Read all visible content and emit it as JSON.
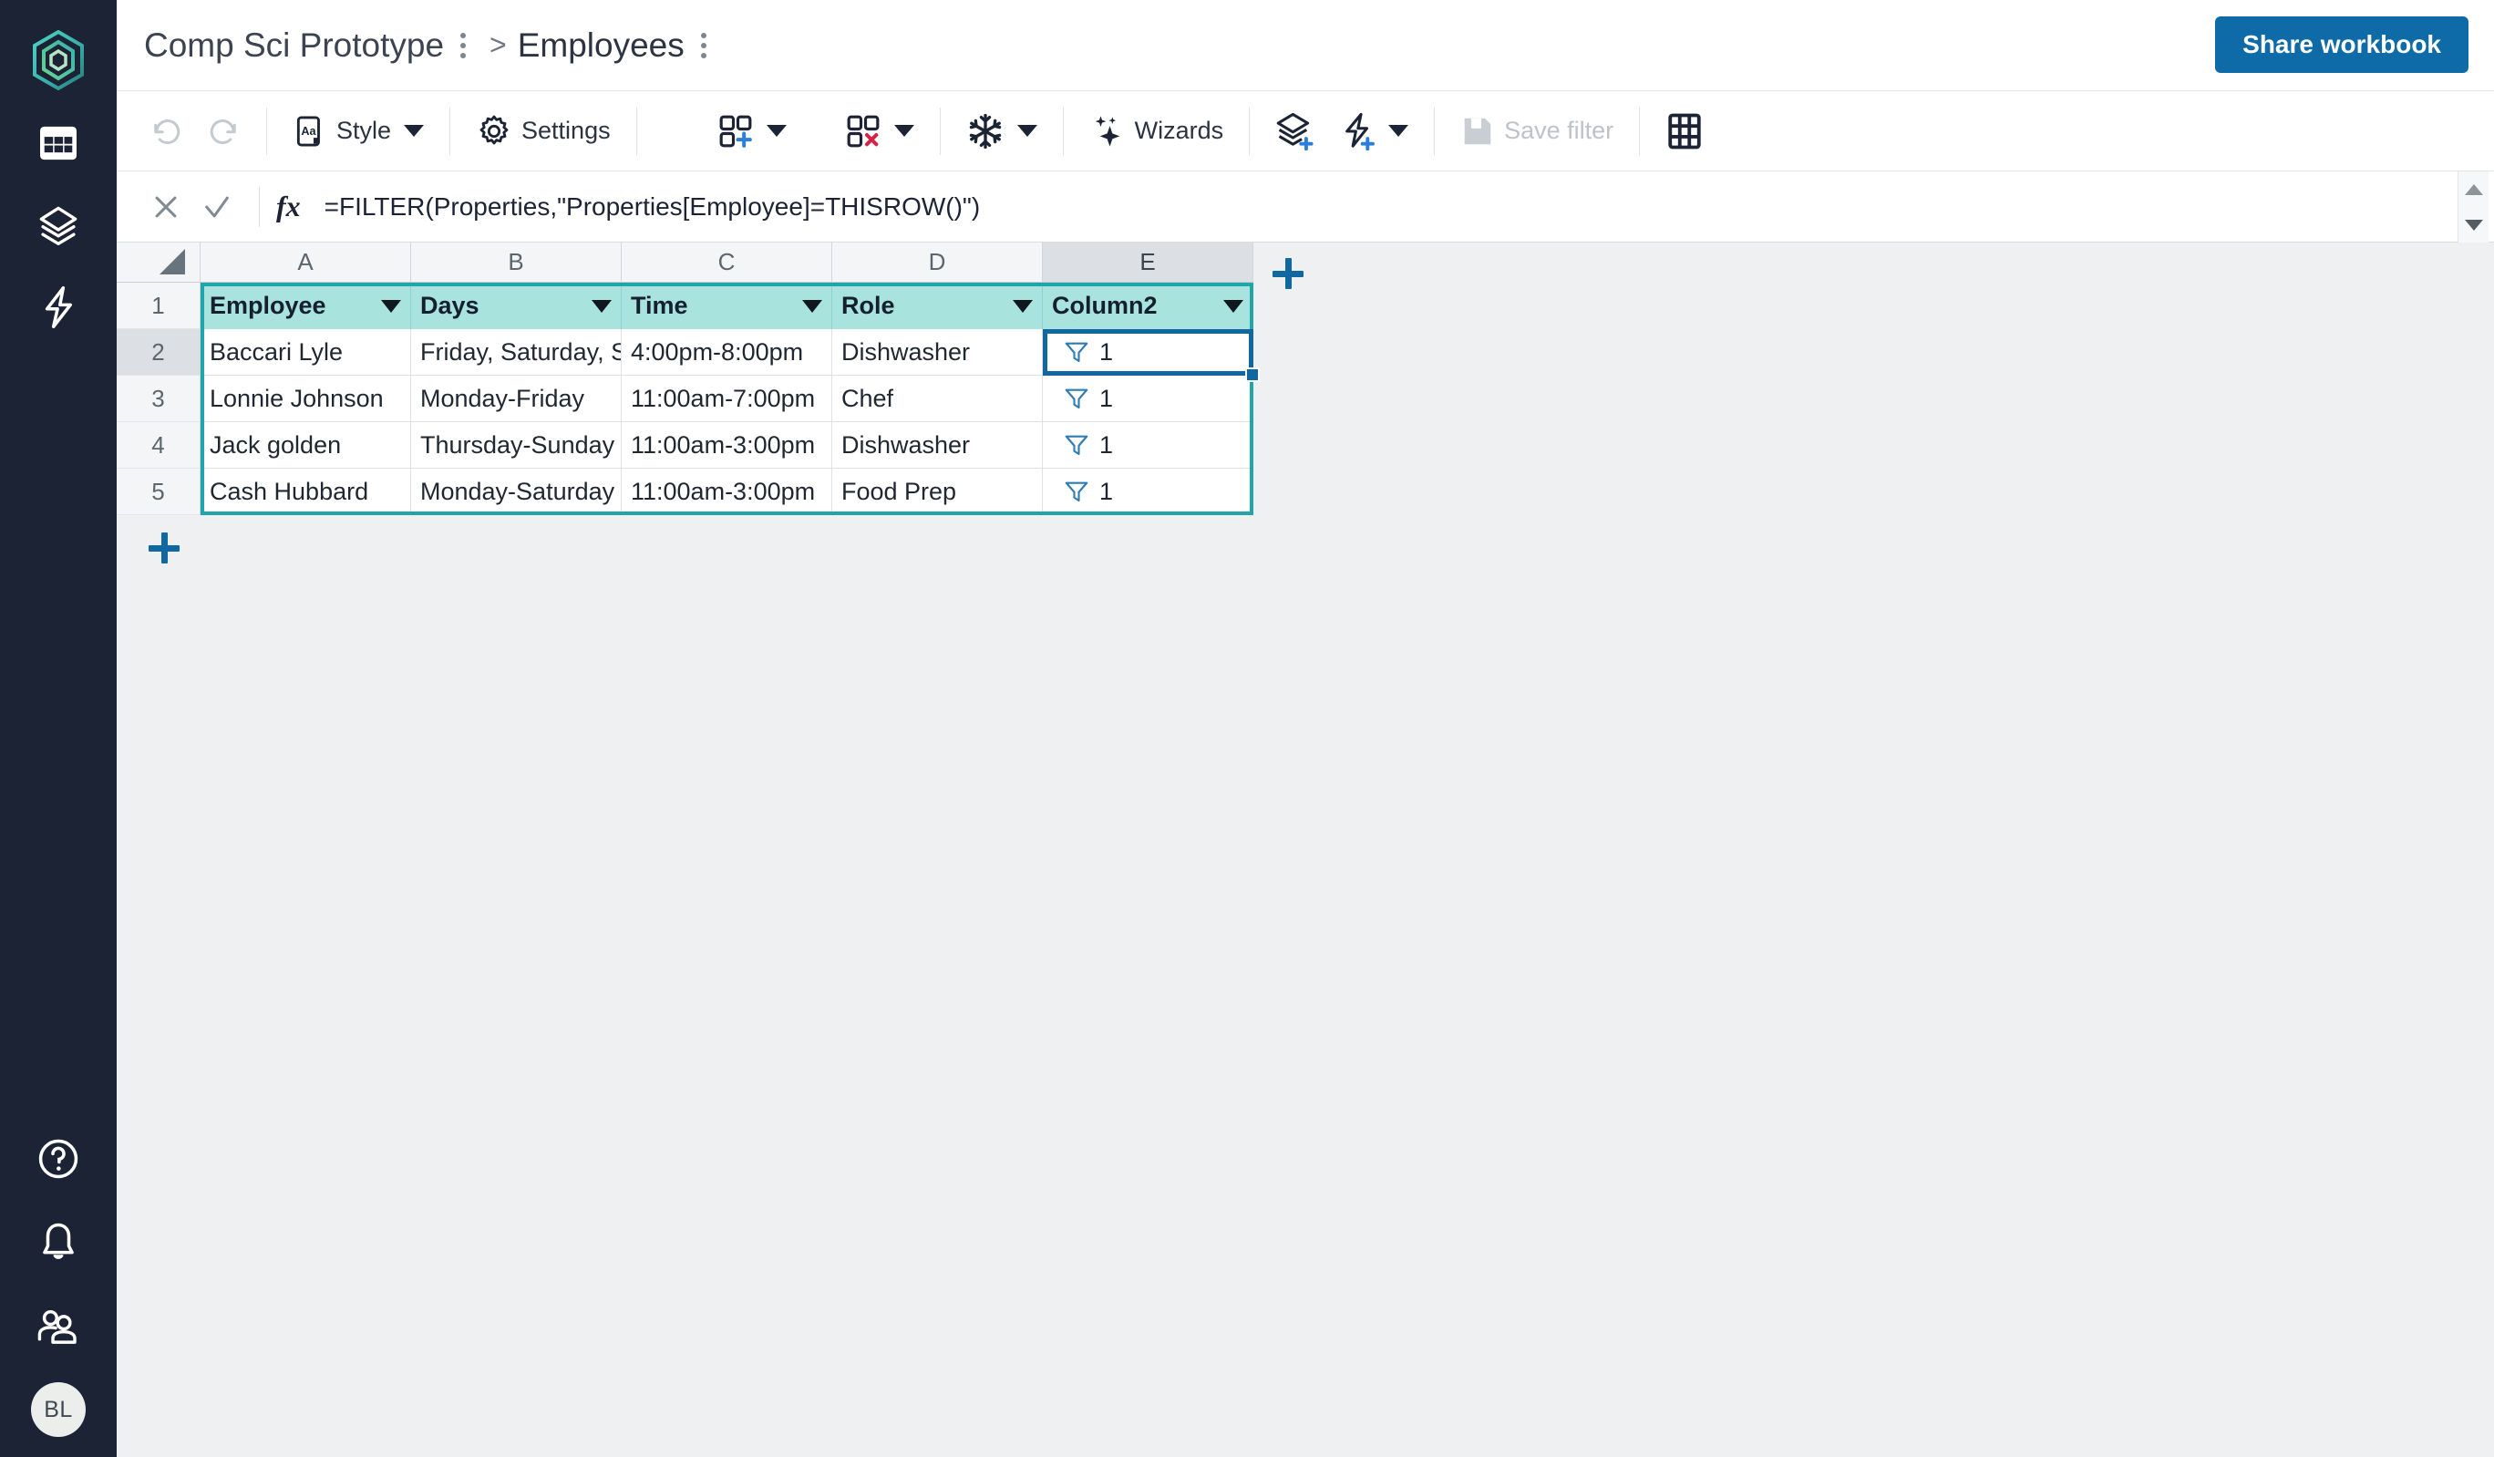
{
  "app": {
    "logo_icon": "hexagon-logo-icon",
    "accent_blue": "#0e6ba8",
    "sidebar_bg": "#1b2334",
    "header_teal": "#a9e3de",
    "table_outline_teal": "#20a5ac"
  },
  "sidebar": {
    "top_items": [
      {
        "name": "tables-icon",
        "label": "Tables"
      },
      {
        "name": "layers-icon",
        "label": "Layers"
      },
      {
        "name": "automations-icon",
        "label": "Automations"
      }
    ],
    "bottom_items": [
      {
        "name": "help-icon",
        "label": "Help"
      },
      {
        "name": "notifications-icon",
        "label": "Notifications"
      },
      {
        "name": "people-icon",
        "label": "People"
      }
    ],
    "avatar_initials": "BL"
  },
  "header": {
    "workbook_name": "Comp Sci Prototype",
    "separator": ">",
    "sheet_name": "Employees",
    "share_button": "Share workbook"
  },
  "toolbar": {
    "undo": "undo-icon",
    "redo": "redo-icon",
    "style_label": "Style",
    "settings_label": "Settings",
    "insert_cells_icon": "insert-cells-icon",
    "delete_cells_icon": "delete-cells-icon",
    "freeze_icon": "freeze-snowflake-icon",
    "wizards_label": "Wizards",
    "add_layer_icon": "add-layer-icon",
    "add-automation_icon": "add-automation-icon",
    "save_filter_label": "Save filter",
    "view_grid_icon": "grid-view-icon"
  },
  "formula_bar": {
    "cancel_icon": "cancel-icon",
    "confirm_icon": "confirm-icon",
    "fx_label": "fx",
    "formula": "=FILTER(Properties,\"Properties[Employee]=THISROW()\")"
  },
  "grid": {
    "column_letters": [
      "A",
      "B",
      "C",
      "D",
      "E"
    ],
    "selected_column": "E",
    "row_numbers": [
      "1",
      "2",
      "3",
      "4",
      "5"
    ],
    "selected_row": "2",
    "selected_cell": "E2",
    "headers": [
      "Employee",
      "Days",
      "Time",
      "Role",
      "Column2"
    ],
    "rows": [
      {
        "row": "2",
        "Employee": "Baccari Lyle",
        "Days": "Friday, Saturday, Sunday",
        "Time": "4:00pm-8:00pm",
        "Role": "Dishwasher",
        "Column2": "1"
      },
      {
        "row": "3",
        "Employee": "Lonnie Johnson",
        "Days": "Monday-Friday",
        "Time": "11:00am-7:00pm",
        "Role": "Chef",
        "Column2": "1"
      },
      {
        "row": "4",
        "Employee": "Jack golden",
        "Days": "Thursday-Sunday",
        "Time": "11:00am-3:00pm",
        "Role": "Dishwasher",
        "Column2": "1"
      },
      {
        "row": "5",
        "Employee": "Cash Hubbard",
        "Days": "Monday-Saturday",
        "Time": "11:00am-3:00pm",
        "Role": "Food Prep",
        "Column2": "1"
      }
    ],
    "filter_icon": "filter-funnel-icon",
    "add_column_button": "+",
    "add_row_button": "+"
  }
}
